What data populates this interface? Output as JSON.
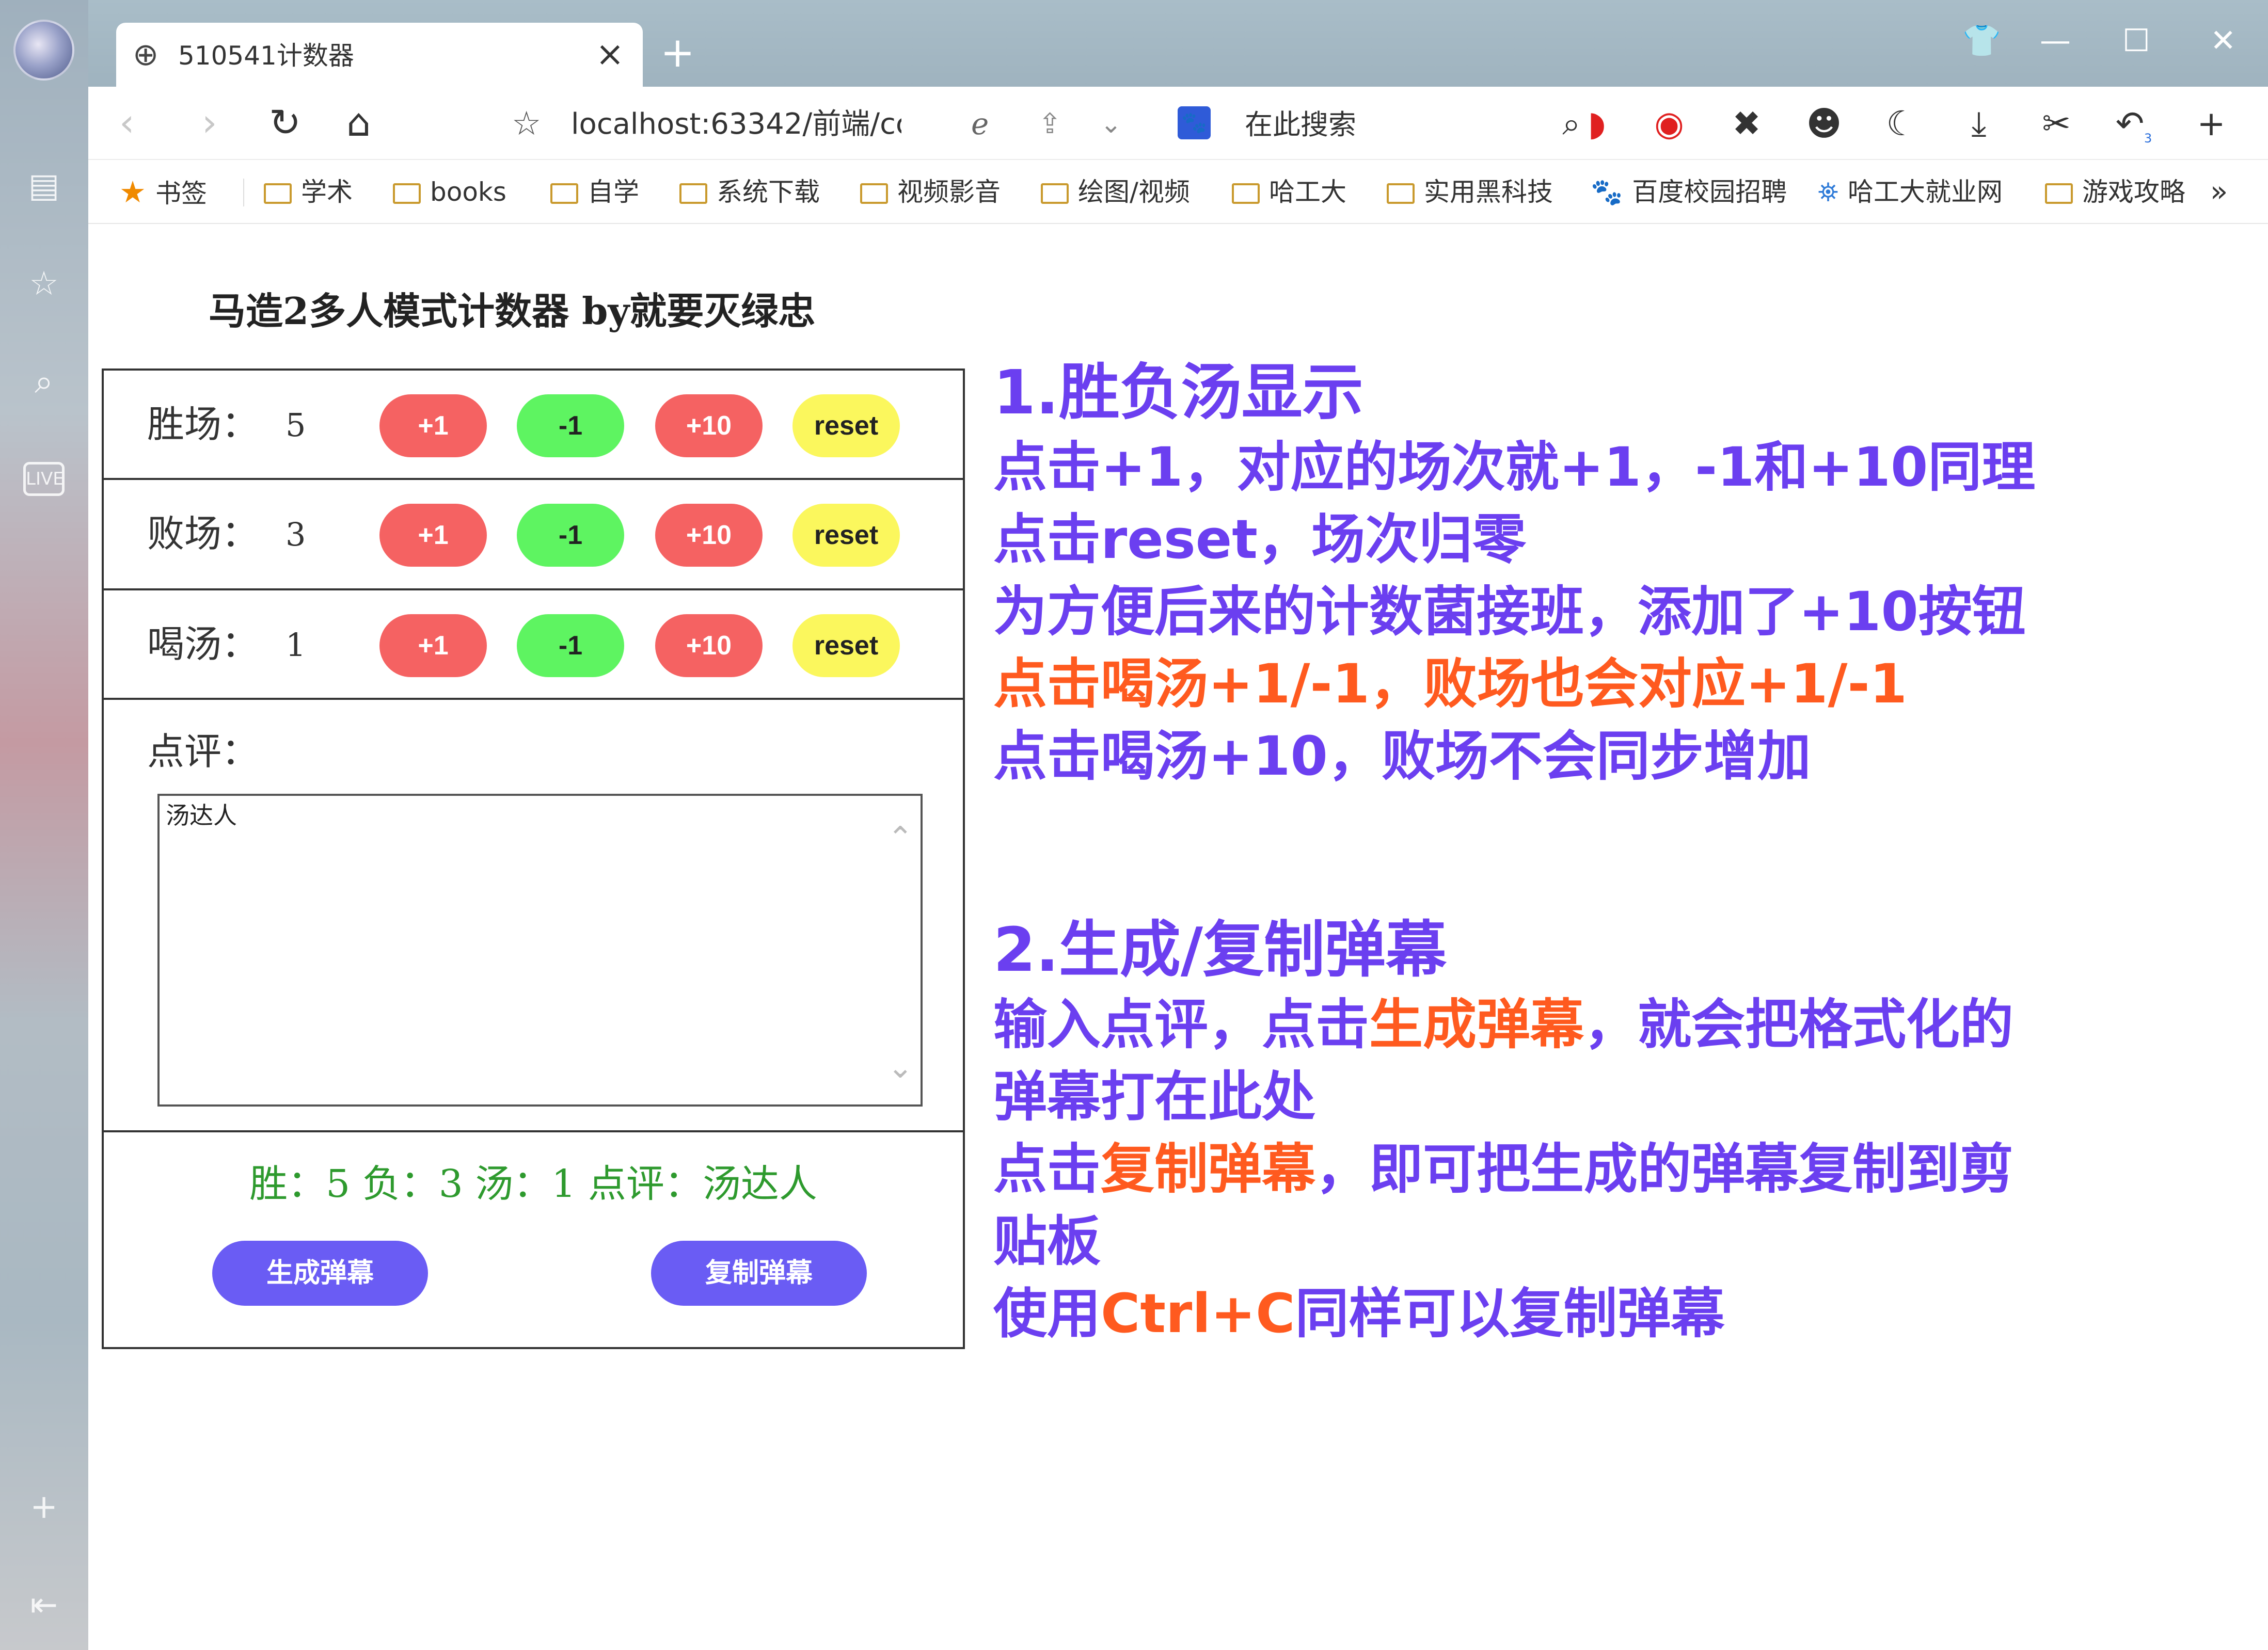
{
  "browser": {
    "tab_title": "510541计数器",
    "address": "localhost:63342/前端/cc",
    "search_placeholder": "在此搜索",
    "bookmarks": [
      "书签",
      "学术",
      "books",
      "自学",
      "系统下载",
      "视频影音",
      "绘图/视频",
      "哈工大",
      "实用黑科技",
      "百度校园招聘",
      "哈工大就业网",
      "游戏攻略"
    ],
    "undo_count": "3"
  },
  "app": {
    "title": "马造2多人模式计数器 by就要灭绿忠",
    "rows": [
      {
        "label": "胜场：",
        "value": "5"
      },
      {
        "label": "败场：",
        "value": "3"
      },
      {
        "label": "喝汤：",
        "value": "1"
      }
    ],
    "buttons": {
      "plus1": "+1",
      "minus1": "-1",
      "plus10": "+10",
      "reset": "reset"
    },
    "review_label": "点评：",
    "review_text": "汤达人",
    "result_text": "胜：5 负：3 汤：1 点评：汤达人",
    "generate_label": "生成弹幕",
    "copy_label": "复制弹幕"
  },
  "notes": {
    "s1_title": "1.胜负汤显示",
    "s1_l1": "点击+1，对应的场次就+1，-1和+10同理",
    "s1_l2": "点击reset，场次归零",
    "s1_l3": "为方便后来的计数菌接班，添加了+10按钮",
    "s1_l4": "点击喝汤+1/-1，败场也会对应+1/-1",
    "s1_l5": "点击喝汤+10，败场不会同步增加",
    "s2_title": "2.生成/复制弹幕",
    "s2_l1_a": "输入点评，点击",
    "s2_l1_b": "生成弹幕",
    "s2_l1_c": "，就会把格式化的",
    "s2_l2": "弹幕打在此处",
    "s2_l3_a": "点击",
    "s2_l3_b": "复制弹幕",
    "s2_l3_c": "，即可把生成的弹幕复制到剪",
    "s2_l4": "贴板",
    "s2_l5_a": "使用",
    "s2_l5_b": "Ctrl+C",
    "s2_l5_c": "同样可以复制弹幕"
  },
  "colors": {
    "note_purple": "#6b3ff0",
    "note_orange": "#ff5a1f",
    "btn_red": "#f56262",
    "btn_green": "#5ef461",
    "btn_yellow": "#fbf75d",
    "btn_purple": "#6a5cf4",
    "result_green": "#2e9a2e"
  }
}
